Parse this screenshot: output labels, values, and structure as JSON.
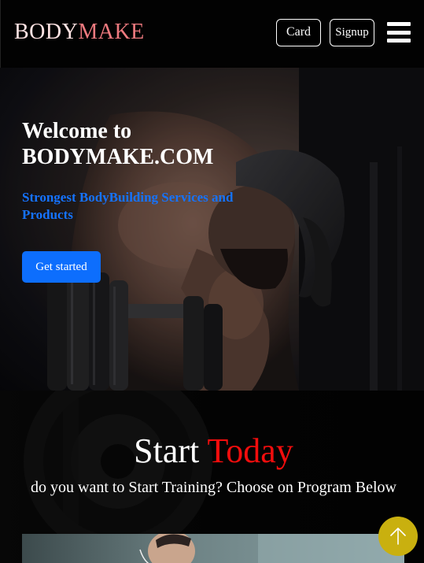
{
  "header": {
    "brand_part1": "BODY",
    "brand_part2": "MAKE",
    "card_label": "Card",
    "signup_label": "Signup",
    "menu_icon": "hamburger-menu-icon"
  },
  "hero": {
    "title": "Welcome to BODYMAKE.COM",
    "subtitle": "Strongest BodyBuilding Services and Products",
    "cta_label": "Get started",
    "background": "bodybuilder-dumbbell-photo"
  },
  "start_section": {
    "title_part1": "Start",
    "title_part2": "Today",
    "subtitle": "do you want to Start Training? Choose on Program Below",
    "background": "weight-plate-photo"
  },
  "scroll_top": {
    "icon": "arrow-up-icon"
  },
  "colors": {
    "brand_light": "#ffe3e3",
    "brand_accent": "#ef7a7f",
    "primary_blue": "#0d6efd",
    "highlight_red": "#f20d0d",
    "scroll_button": "#c9b00f"
  }
}
